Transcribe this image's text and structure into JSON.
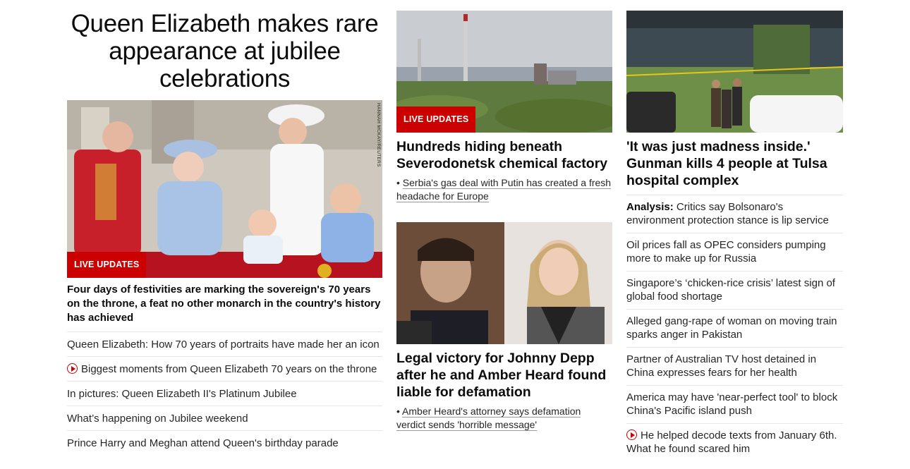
{
  "left": {
    "headline": "Queen Elizabeth makes rare appearance at jubilee celebrations",
    "image_credit": "HANNAH MCKAY/REUTERS",
    "badge": "LIVE UPDATES",
    "lead": "Four days of festivities are marking the sovereign's 70 years on the throne, a feat no other monarch in the country's history has achieved",
    "links": [
      {
        "text": "Queen Elizabeth: How 70 years of portraits have made her an icon",
        "video": false
      },
      {
        "text": "Biggest moments from Queen Elizabeth 70 years on the throne",
        "video": true
      },
      {
        "text": "In pictures: Queen Elizabeth II's Platinum Jubilee",
        "video": false
      },
      {
        "text": "What’s happening on Jubilee weekend",
        "video": false
      },
      {
        "text": "Prince Harry and Meghan attend Queen's birthday parade",
        "video": false
      }
    ]
  },
  "mid": {
    "story1": {
      "badge": "LIVE UPDATES",
      "headline": "Hundreds hiding beneath Severodonetsk chemical factory",
      "sub": "Serbia's gas deal with Putin has created a fresh headache for Europe"
    },
    "story2": {
      "headline": "Legal victory for Johnny Depp after he and Amber Heard found liable for defamation",
      "sub": "Amber Heard's attorney says defamation verdict sends 'horrible message'"
    }
  },
  "right": {
    "headline": "'It was just madness inside.' Gunman kills 4 people at Tulsa hospital complex",
    "items": [
      {
        "prefix": "Analysis:",
        "text": "Critics say Bolsonaro's environment protection stance is lip service",
        "video": false
      },
      {
        "prefix": "",
        "text": "Oil prices fall as OPEC considers pumping more to make up for Russia",
        "video": false
      },
      {
        "prefix": "",
        "text": "Singapore’s ‘chicken-rice crisis’ latest sign of global food shortage",
        "video": false
      },
      {
        "prefix": "",
        "text": "Alleged gang-rape of woman on moving train sparks anger in Pakistan",
        "video": false
      },
      {
        "prefix": "",
        "text": "Partner of Australian TV host detained in China expresses fears for her health",
        "video": false
      },
      {
        "prefix": "",
        "text": "America may have 'near-perfect tool' to block China's Pacific island push",
        "video": false
      },
      {
        "prefix": "",
        "text": "He helped decode texts from January 6th. What he found scared him",
        "video": true
      }
    ]
  },
  "colors": {
    "accent": "#cc0000",
    "divider": "#e6e6e6"
  }
}
